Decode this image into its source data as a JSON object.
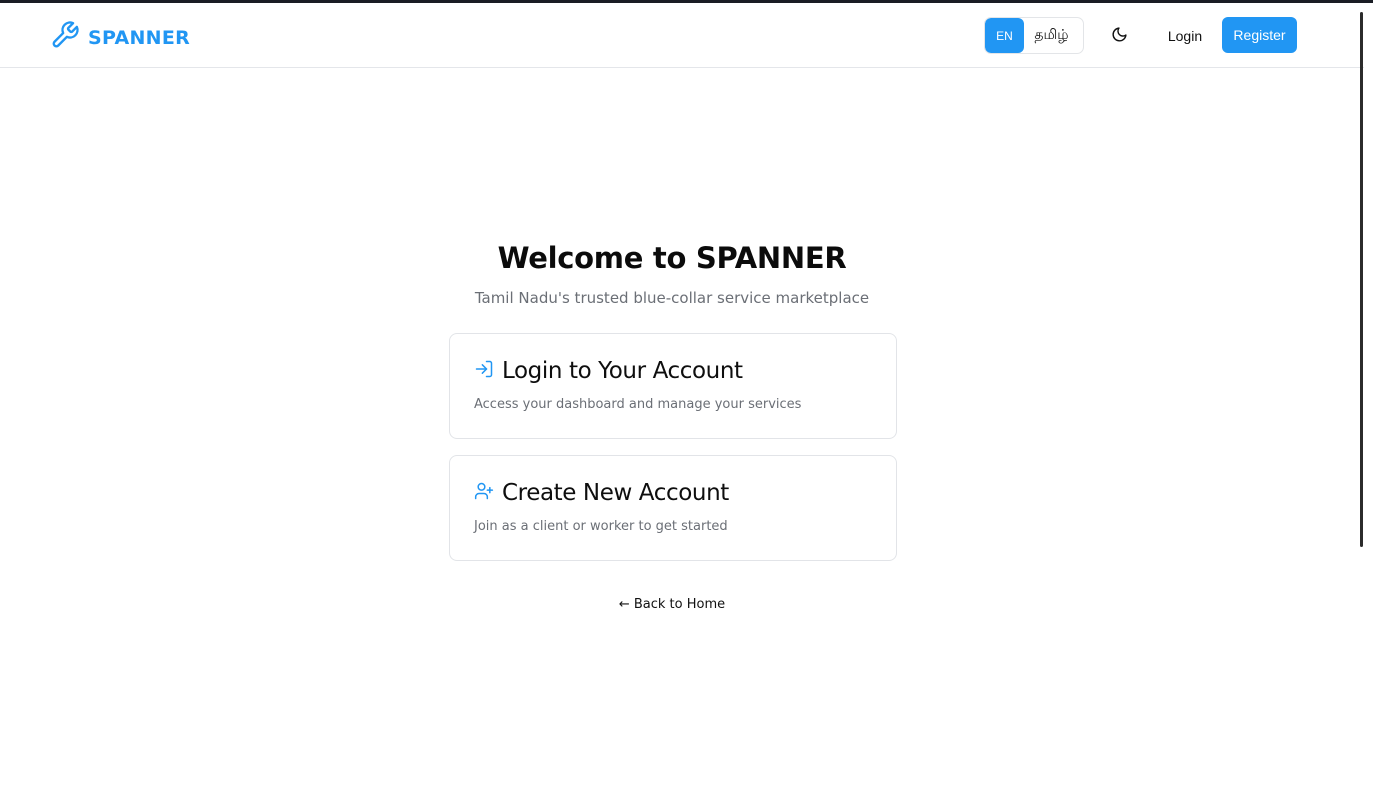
{
  "header": {
    "brand": "SPANNER",
    "language": {
      "options": [
        "EN",
        "தமிழ்"
      ],
      "selected": "EN"
    },
    "login_label": "Login",
    "register_label": "Register"
  },
  "colors": {
    "accent": "#2196f3",
    "text": "#0b0b0b",
    "muted": "#6b6f76",
    "border": "#e2e4e8"
  },
  "icons": {
    "logo": "wrench-icon",
    "theme": "moon-icon",
    "login_card": "log-in-icon",
    "create_card": "user-plus-icon"
  },
  "main": {
    "title": "Welcome to SPANNER",
    "subtitle": "Tamil Nadu's trusted blue-collar service marketplace",
    "cards": [
      {
        "title": "Login to Your Account",
        "description": "Access your dashboard and manage your services"
      },
      {
        "title": "Create New Account",
        "description": "Join as a client or worker to get started"
      }
    ],
    "back_link": "← Back to Home"
  }
}
